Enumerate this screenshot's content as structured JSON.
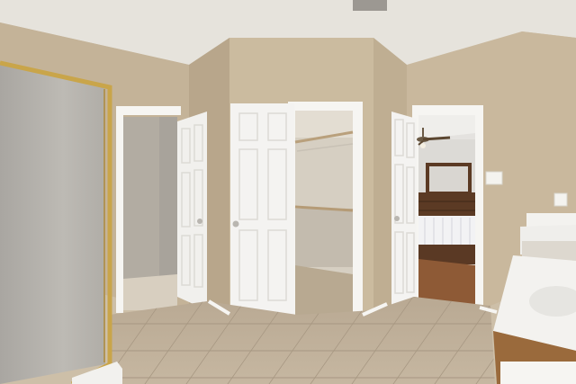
{
  "scene": {
    "subject": "bathroom",
    "colors": {
      "wall": "#c9b89d",
      "wall_shadow": "#b8a68b",
      "ceiling": "#e6e3dc",
      "floor_tile": "#c2b29c",
      "door": "#f4f3f1",
      "trim": "#f6f5f2",
      "closet_wall": "#d6cfc2",
      "bedroom_floor": "#8e5a36",
      "dresser": "#5b3a24",
      "glass": "#bdbab4",
      "shower_frame": "#c9a54a",
      "vanity_top": "#f3f2ef",
      "vanity_cabinet": "#9a6a3c"
    }
  }
}
